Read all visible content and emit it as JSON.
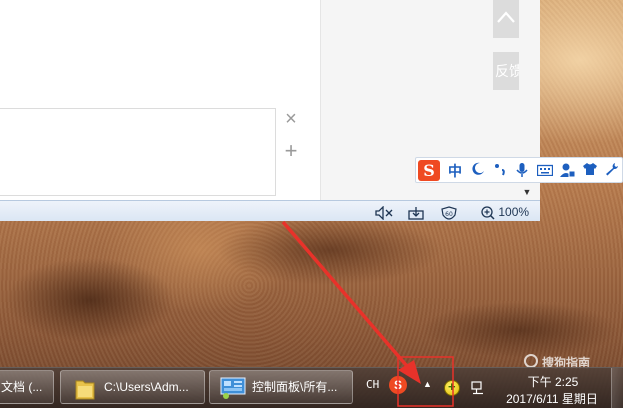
{
  "browser": {
    "feedback_label": "反馈",
    "close_glyph": "×",
    "add_glyph": "+",
    "status_bar": {
      "zoom_label": "100%"
    }
  },
  "ime": {
    "logo_letter": "S",
    "mode_label": "中",
    "items": [
      "moon-icon",
      "punctuation-icon",
      "microphone-icon",
      "keyboard-icon",
      "user-icon",
      "skin-shirt-icon",
      "settings-wrench-icon"
    ],
    "dropdown_glyph": "▼"
  },
  "taskbar": {
    "buttons": [
      {
        "label": "文档 (...",
        "icon": "document-icon"
      },
      {
        "label": "C:\\Users\\Adm...",
        "icon": "folder-icon"
      },
      {
        "label": "控制面板\\所有...",
        "icon": "control-panel-icon"
      }
    ],
    "tray": {
      "language": "CH",
      "ime_letter": "S",
      "show_hidden_glyph": "▲"
    },
    "clock": {
      "time": "下午 2:25",
      "date": "2017/6/11 星期日"
    }
  },
  "watermark": {
    "text": "搜狗指南"
  },
  "colors": {
    "accent_red": "#e8322a",
    "sogou_orange": "#ef4a22",
    "ime_blue": "#1d5fbf"
  }
}
